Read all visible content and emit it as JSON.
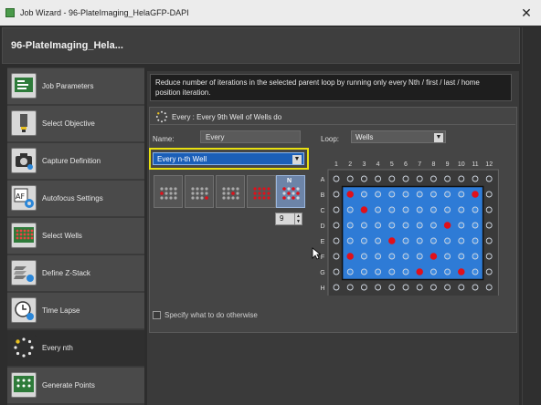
{
  "window": {
    "title": "Job Wizard - 96-PlateImaging_HelaGFP-DAPI",
    "close_glyph": "✕"
  },
  "header": {
    "title": "96-PlateImaging_Hela..."
  },
  "sidebar": {
    "items": [
      {
        "label": "Job Parameters",
        "icon": "job-parameters-icon"
      },
      {
        "label": "Select Objective",
        "icon": "objective-icon"
      },
      {
        "label": "Capture Definition",
        "icon": "camera-icon"
      },
      {
        "label": "Autofocus Settings",
        "icon": "autofocus-icon"
      },
      {
        "label": "Select Wells",
        "icon": "wells-icon"
      },
      {
        "label": "Define Z-Stack",
        "icon": "z-stack-icon"
      },
      {
        "label": "Time Lapse",
        "icon": "clock-icon"
      },
      {
        "label": "Every nth",
        "icon": "every-nth-icon",
        "active": true
      },
      {
        "label": "Generate Points",
        "icon": "generate-points-icon"
      }
    ]
  },
  "description": "Reduce number of iterations in the selected parent loop by running only every Nth / first / last / home position iteration.",
  "panel": {
    "title": "Every : Every 9th Well of Wells do",
    "name_label": "Name:",
    "name_value": "Every",
    "loop_label": "Loop:",
    "loop_value": "Wells",
    "mode_value": "Every n-th Well",
    "n_value": "9",
    "pattern_selected_label": "N",
    "otherwise_label": "Specify what to do otherwise",
    "otherwise_checked": false
  },
  "plate": {
    "columns": [
      "1",
      "2",
      "3",
      "4",
      "5",
      "6",
      "7",
      "8",
      "9",
      "10",
      "11",
      "12"
    ],
    "rows": [
      "A",
      "B",
      "C",
      "D",
      "E",
      "F",
      "G",
      "H"
    ],
    "selected_rows": [
      "B",
      "C",
      "D",
      "E",
      "F",
      "G"
    ],
    "selected_cols": [
      "2",
      "3",
      "4",
      "5",
      "6",
      "7",
      "8",
      "9",
      "10",
      "11"
    ],
    "active_wells": [
      "B2",
      "B11",
      "C3",
      "D9",
      "E5",
      "F2",
      "F8",
      "G7",
      "G10"
    ],
    "colors": {
      "selection": "#2e7bd6",
      "active": "#e0101a",
      "well": "#cfd6e0"
    }
  }
}
